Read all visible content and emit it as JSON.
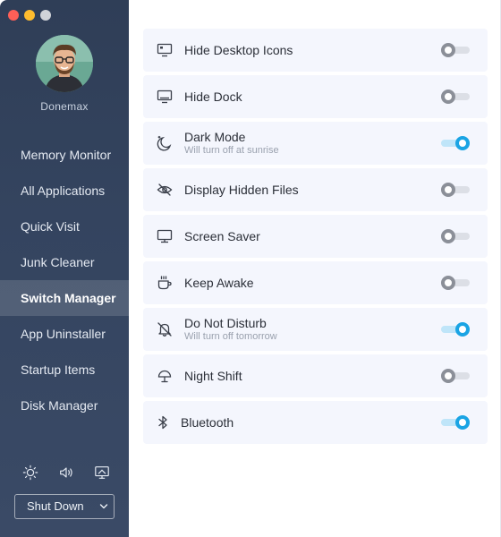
{
  "window": {
    "traffic_lights": [
      {
        "name": "close",
        "color": "#fe5f57"
      },
      {
        "name": "minimize",
        "color": "#febc2e"
      },
      {
        "name": "zoom",
        "color": "#d0d3d8"
      }
    ]
  },
  "sidebar": {
    "username": "Donemax",
    "items": [
      {
        "label": "Memory Monitor",
        "active": false
      },
      {
        "label": "All Applications",
        "active": false
      },
      {
        "label": "Quick Visit",
        "active": false
      },
      {
        "label": "Junk Cleaner",
        "active": false
      },
      {
        "label": "Switch Manager",
        "active": true
      },
      {
        "label": "App Uninstaller",
        "active": false
      },
      {
        "label": "Startup Items",
        "active": false
      },
      {
        "label": "Disk Manager",
        "active": false
      }
    ],
    "bottom_icons": [
      "brightness-icon",
      "volume-icon",
      "display-icon"
    ],
    "shutdown_label": "Shut Down"
  },
  "switches": [
    {
      "icon": "desktop-icon",
      "title": "Hide Desktop Icons",
      "subtitle": "",
      "on": false
    },
    {
      "icon": "dock-icon",
      "title": "Hide Dock",
      "subtitle": "",
      "on": false
    },
    {
      "icon": "dark-mode-icon",
      "title": "Dark Mode",
      "subtitle": "Will turn off at sunrise",
      "on": true
    },
    {
      "icon": "hidden-files-icon",
      "title": "Display Hidden Files",
      "subtitle": "",
      "on": false
    },
    {
      "icon": "screen-saver-icon",
      "title": "Screen Saver",
      "subtitle": "",
      "on": false
    },
    {
      "icon": "coffee-cup-icon",
      "title": "Keep Awake",
      "subtitle": "",
      "on": false
    },
    {
      "icon": "bell-off-icon",
      "title": "Do Not Disturb",
      "subtitle": "Will turn off tomorrow",
      "on": true
    },
    {
      "icon": "night-shift-icon",
      "title": "Night Shift",
      "subtitle": "",
      "on": false
    },
    {
      "icon": "bluetooth-icon",
      "title": "Bluetooth",
      "subtitle": "",
      "on": true
    }
  ],
  "colors": {
    "accent": "#1aa4e4",
    "sidebar": "#34445f",
    "row_bg": "#f4f6fd"
  }
}
